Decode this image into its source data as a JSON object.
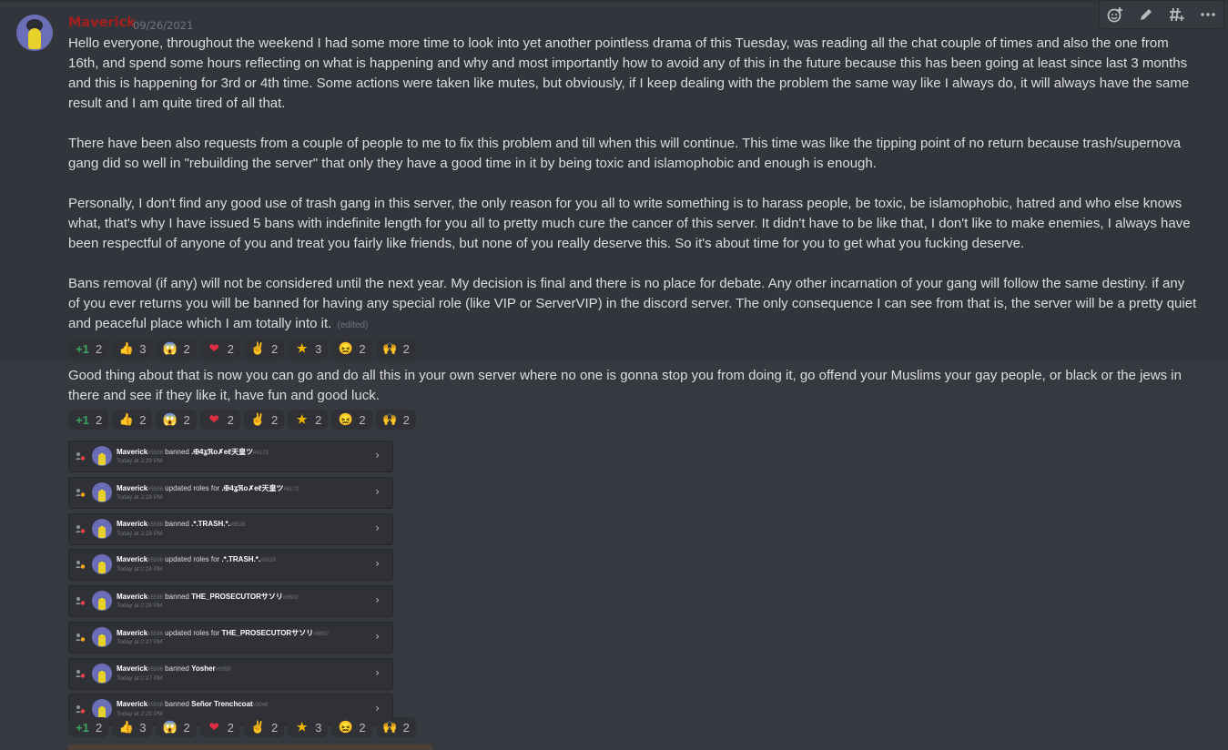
{
  "message": {
    "author": "Maverick",
    "timestamp": "09/26/2021",
    "toolbar": [
      "add-reaction-icon",
      "edit-icon",
      "create-thread-icon",
      "more-icon"
    ],
    "paragraphs": [
      "Hello everyone, throughout the weekend I had some more time to look into yet another pointless drama of this Tuesday, was reading all the chat couple of times and also the one from 16th, and spend some hours reflecting on what is happening and why and most importantly how to avoid any of this in the future because this has been going at least since last 3 months and this is happening for 3rd or 4th time. Some actions were taken like mutes, but obviously, if I keep dealing with the problem the same way like I always do, it will always have the same result and I am quite tired of all that.",
      "There have been also requests from a couple of people to me to fix this problem and till when this will continue. This time was like the tipping point of no return because trash/supernova gang did so well in \"rebuilding the server\" that only they have a good time in it by being toxic and islamophobic and enough is enough.",
      "Personally, I don't find any good use of trash gang in this server, the only reason for you all to write something is to harass people, be toxic, be islamophobic, hatred and who else knows what, that's why I have issued 5 bans with indefinite length for you all to pretty much cure the cancer of this server. It didn't have to be like that, I don't like to make enemies, I always have been respectful of anyone of you and treat you fairly like friends, but none of you really deserve this. So it's about time for you to get what you fucking deserve.",
      "Bans removal (if any) will not be considered until the next year. My decision is final and there is no place for debate. Any other incarnation of your gang will follow the same destiny. if any of you ever returns you will be banned for having any special role (like VIP or ServerVIP) in the discord server. The only  consequence I can see from that is, the server will be a pretty quiet and peaceful place which I am totally into it."
    ],
    "edited_label": "(edited)",
    "reactions_1": [
      {
        "icon": "plus-one-icon",
        "glyph": "+1",
        "count": "2"
      },
      {
        "icon": "thumbs-up-character-icon",
        "glyph": "👍",
        "count": "3"
      },
      {
        "icon": "scream-icon",
        "glyph": "😱",
        "count": "2"
      },
      {
        "icon": "heart-icon",
        "glyph": "❤",
        "count": "2"
      },
      {
        "icon": "victory-hand-icon",
        "glyph": "✌",
        "count": "2"
      },
      {
        "icon": "you-tried-star-icon",
        "glyph": "★",
        "count": "3"
      },
      {
        "icon": "face-emote-icon",
        "glyph": "😖",
        "count": "2"
      },
      {
        "icon": "figure-emote-icon",
        "glyph": "🙌",
        "count": "2"
      }
    ],
    "followup": "Good thing about that is now you can go and do all this in your own server where no one is gonna stop you from doing it, go offend your Muslims your gay people, or black or the jews in there and see if they like it, have fun and good luck.",
    "reactions_2": [
      {
        "icon": "plus-one-icon",
        "glyph": "+1",
        "count": "2"
      },
      {
        "icon": "thumbs-up-character-icon",
        "glyph": "👍",
        "count": "2"
      },
      {
        "icon": "scream-icon",
        "glyph": "😱",
        "count": "2"
      },
      {
        "icon": "heart-icon",
        "glyph": "❤",
        "count": "2"
      },
      {
        "icon": "victory-hand-icon",
        "glyph": "✌",
        "count": "2"
      },
      {
        "icon": "you-tried-star-icon",
        "glyph": "★",
        "count": "2"
      },
      {
        "icon": "face-emote-icon",
        "glyph": "😖",
        "count": "2"
      },
      {
        "icon": "figure-emote-icon",
        "glyph": "🙌",
        "count": "2"
      }
    ],
    "audit_log": [
      {
        "actor": "Maverick",
        "actor_tag": "#5596",
        "action": "banned",
        "target": ".✠4ʓℜo✗eℓ天皇ツ",
        "target_tag": "#6172",
        "time": "Today at 2:29 PM"
      },
      {
        "actor": "Maverick",
        "actor_tag": "#5596",
        "action": "updated roles for",
        "target": ".✠4ʓℜo✗eℓ天皇ツ",
        "target_tag": "#6172",
        "time": "Today at 2:28 PM"
      },
      {
        "actor": "Maverick",
        "actor_tag": "#5596",
        "action": "banned",
        "target": ".*.TRASH.*.",
        "target_tag": "#9528",
        "time": "Today at 2:28 PM"
      },
      {
        "actor": "Maverick",
        "actor_tag": "#5596",
        "action": "updated roles for",
        "target": ".*.TRASH.*.",
        "target_tag": "#9528",
        "time": "Today at 2:28 PM"
      },
      {
        "actor": "Maverick",
        "actor_tag": "#5596",
        "action": "banned",
        "target": "THE_PROSECUTORサソリ",
        "target_tag": "#8802",
        "time": "Today at 2:28 PM"
      },
      {
        "actor": "Maverick",
        "actor_tag": "#5596",
        "action": "updated roles for",
        "target": "THE_PROSECUTORサソリ",
        "target_tag": "#8802",
        "time": "Today at 2:27 PM"
      },
      {
        "actor": "Maverick",
        "actor_tag": "#5596",
        "action": "banned",
        "target": "Yosher",
        "target_tag": "#0959",
        "time": "Today at 2:27 PM"
      },
      {
        "actor": "Maverick",
        "actor_tag": "#5596",
        "action": "banned",
        "target": "Señor Trenchcoat",
        "target_tag": "#3046",
        "time": "Today at 2:25 PM"
      }
    ],
    "reactions_3": [
      {
        "icon": "plus-one-icon",
        "glyph": "+1",
        "count": "2"
      },
      {
        "icon": "thumbs-up-character-icon",
        "glyph": "👍",
        "count": "3"
      },
      {
        "icon": "scream-icon",
        "glyph": "😱",
        "count": "2"
      },
      {
        "icon": "heart-icon",
        "glyph": "❤",
        "count": "2"
      },
      {
        "icon": "victory-hand-icon",
        "glyph": "✌",
        "count": "2"
      },
      {
        "icon": "you-tried-star-icon",
        "glyph": "★",
        "count": "3"
      },
      {
        "icon": "face-emote-icon",
        "glyph": "😖",
        "count": "2"
      },
      {
        "icon": "figure-emote-icon",
        "glyph": "🙌",
        "count": "2"
      }
    ]
  }
}
